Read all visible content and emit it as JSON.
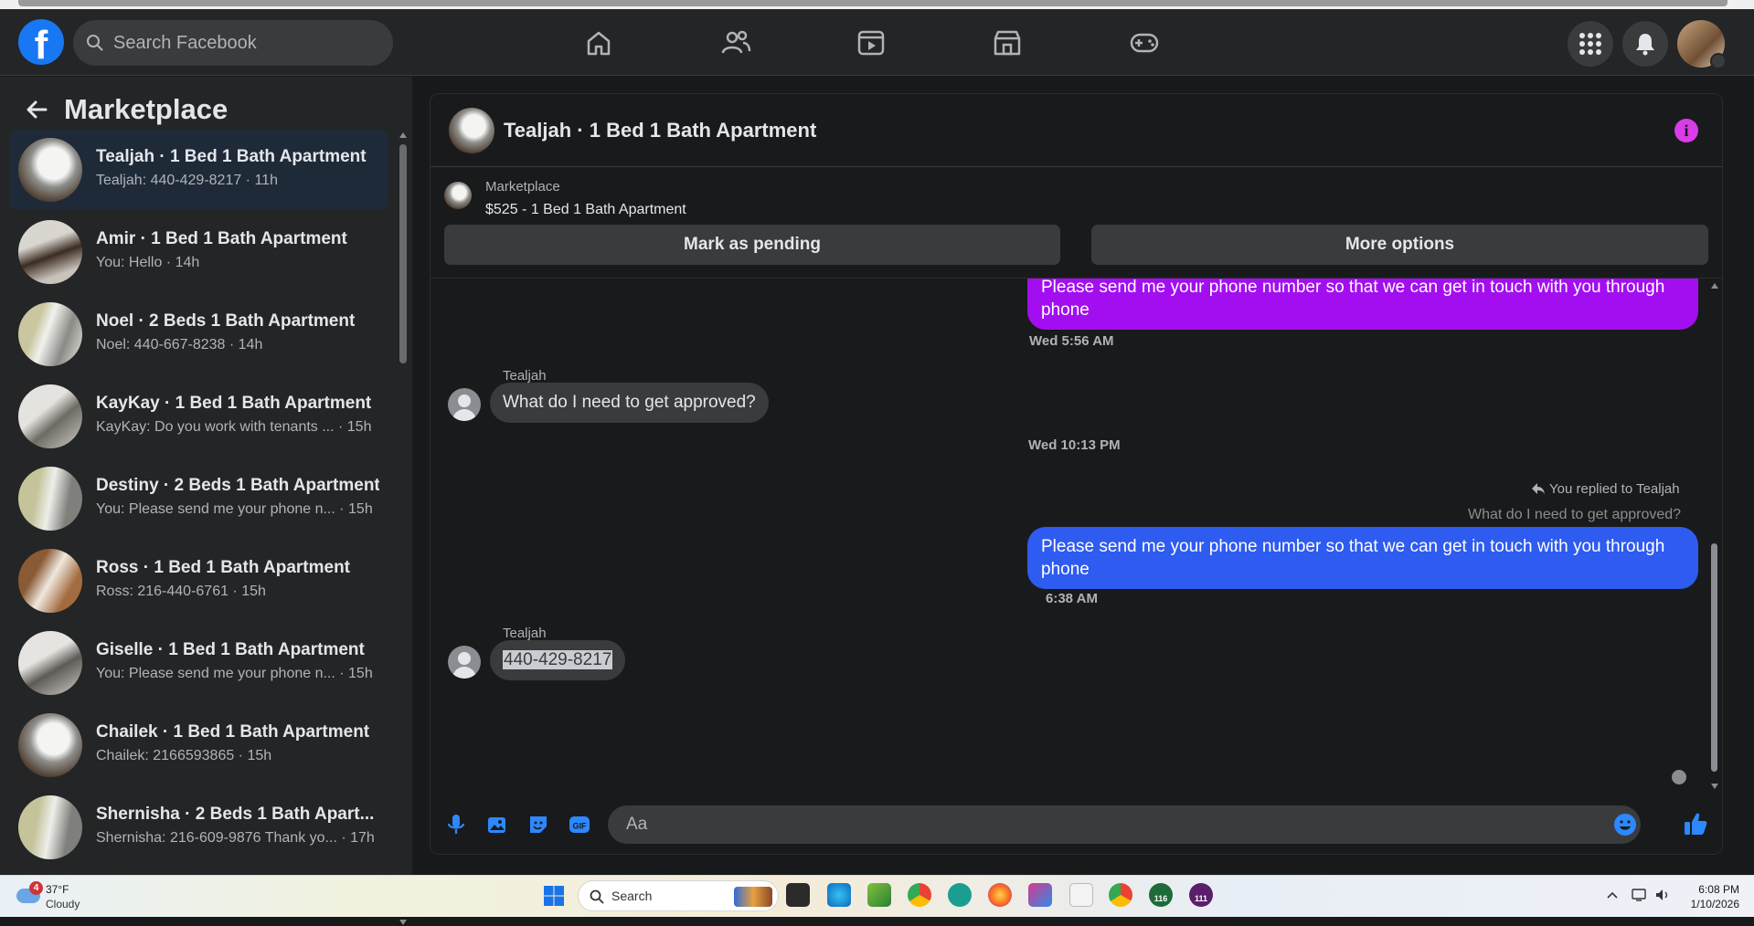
{
  "header": {
    "search_placeholder": "Search Facebook"
  },
  "sidebar": {
    "title": "Marketplace",
    "conversations": [
      {
        "title": "Tealjah · 1 Bed 1 Bath Apartment",
        "preview": "Tealjah: 440-429-8217 · 11h"
      },
      {
        "title": "Amir · 1 Bed 1 Bath Apartment",
        "preview": "You: Hello · 14h"
      },
      {
        "title": "Noel · 2 Beds 1 Bath Apartment",
        "preview": "Noel: 440-667-8238 · 14h"
      },
      {
        "title": "KayKay · 1 Bed 1 Bath Apartment",
        "preview": "KayKay: Do you work with tenants ... · 15h"
      },
      {
        "title": "Destiny · 2 Beds 1 Bath Apartment",
        "preview": "You: Please send me your phone n... · 15h"
      },
      {
        "title": "Ross · 1 Bed 1 Bath Apartment",
        "preview": "Ross: 216-440-6761 · 15h"
      },
      {
        "title": "Giselle · 1 Bed 1 Bath Apartment",
        "preview": "You: Please send me your phone n... · 15h"
      },
      {
        "title": "Chailek · 1 Bed 1 Bath Apartment",
        "preview": "Chailek: 2166593865 · 15h"
      },
      {
        "title": "Shernisha · 2 Beds 1 Bath Apart...",
        "preview": "Shernisha: 216-609-9876 Thank yo... · 17h"
      }
    ]
  },
  "chat": {
    "title": "Tealjah · 1 Bed 1 Bath Apartment",
    "info_icon_label": "i",
    "listing_source": "Marketplace",
    "listing_price_title": "$525 - 1 Bed 1 Bath Apartment",
    "mark_pending_label": "Mark as pending",
    "more_options_label": "More options",
    "messages": {
      "out_1": "Please send me your phone  number so that we can get in touch with you through phone",
      "ts_1": "Wed 5:56 AM",
      "sender_1": "Tealjah",
      "in_1": "What do I need to get approved?",
      "ts_2": "Wed 10:13 PM",
      "reply_note": "You replied to Tealjah",
      "reply_quote": "What do I need to get approved?",
      "out_2": "Please send me your phone  number so that we can get in touch with you through phone",
      "ts_3": "6:38 AM",
      "sender_2": "Tealjah",
      "in_2": "440-429-8217"
    },
    "composer_placeholder": "Aa"
  },
  "taskbar": {
    "weather_badge": "4",
    "temperature": "37°F",
    "condition": "Cloudy",
    "search_label": "Search",
    "time": "6:08 PM",
    "date": "1/10/2026",
    "badge_116": "116",
    "badge_111": "111"
  },
  "colors": {
    "accent_blue": "#1877f2",
    "bubble_purple": "#a30ef0",
    "bubble_blue": "#2e5bf0"
  }
}
